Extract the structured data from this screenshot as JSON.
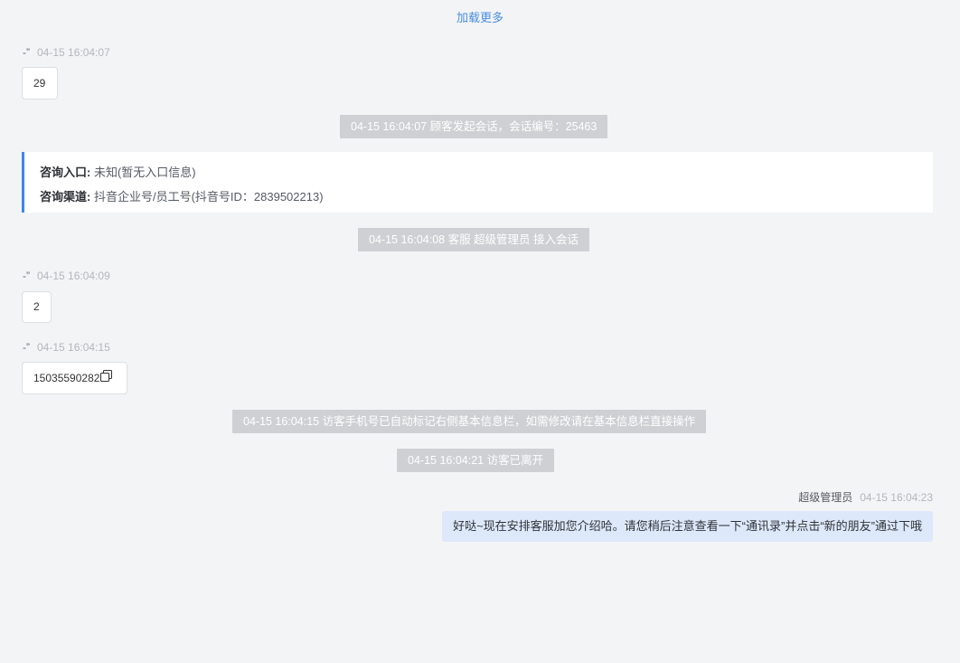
{
  "load_more": "加载更多",
  "messages": [
    {
      "sender": "-”",
      "time": "04-15 16:04:07",
      "text": "29"
    },
    {
      "sender": "-”",
      "time": "04-15 16:04:09",
      "text": "2"
    },
    {
      "sender": "-”",
      "time": "04-15 16:04:15",
      "text": "15035590282",
      "icon": "copy-icon"
    }
  ],
  "system_notices": [
    "04-15 16:04:07 顾客发起会话，会话编号：25463",
    "04-15 16:04:08 客服 超级管理员 接入会话",
    "04-15 16:04:15 访客手机号已自动标记右侧基本信息栏，如需修改请在基本信息栏直接操作",
    "04-15 16:04:21 访客已离开"
  ],
  "consult_info": {
    "entry_label": "咨询入口:",
    "entry_value": "未知(暂无入口信息)",
    "channel_label": "咨询渠道:",
    "channel_value": "抖音企业号/员工号(抖音号ID：2839502213)"
  },
  "agent_message": {
    "name": "超级管理员",
    "time": "04-15 16:04:23",
    "text": "好哒~现在安排客服加您介绍哈。请您稍后注意查看一下“通讯录”并点击“新的朋友”通过下哦"
  },
  "colors": {
    "background": "#f3f4f6",
    "link": "#4a8ee0",
    "system_notice_bg": "#cfd0d3",
    "card_accent": "#3d86f0",
    "agent_bubble_bg": "#dde8fb"
  }
}
